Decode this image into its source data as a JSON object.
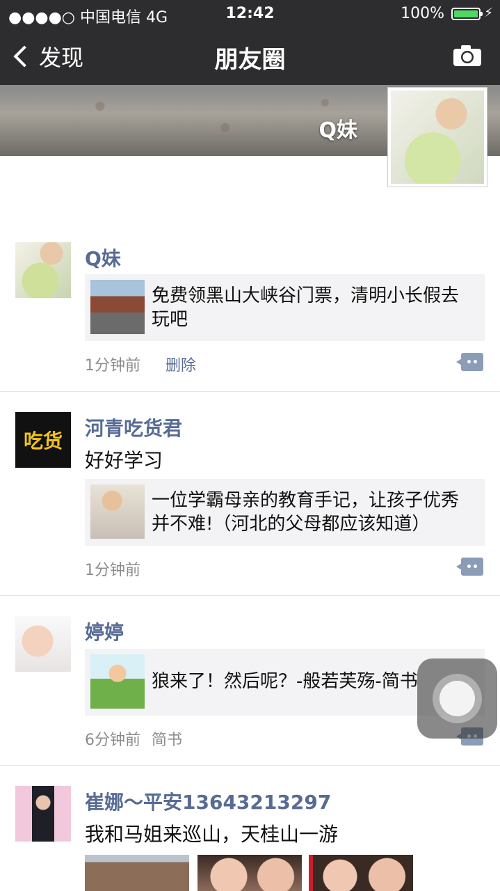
{
  "status_bar": {
    "carrier": "●●●●○ 中国电信  4G",
    "time": "12:42",
    "battery_percent": "100%",
    "battery_level": 1.0,
    "charging_icon": "⚡"
  },
  "nav": {
    "back_label": "发现",
    "title": "朋友圈",
    "camera_icon": "camera-icon"
  },
  "cover": {
    "name": "Q妹"
  },
  "posts": [
    {
      "user": "Q妹",
      "share_text": "免费领黑山大峡谷门票，清明小长假去玩吧",
      "time": "1分钟前",
      "delete_label": "删除"
    },
    {
      "user": "河青吃货君",
      "text": "好好学习",
      "share_text": "一位学霸母亲的教育手记，让孩子优秀并不难!（河北的父母都应该知道）",
      "time": "1分钟前",
      "avatar_text": "吃货"
    },
    {
      "user": "婷婷",
      "share_text": "狼来了！然后呢？-般若芙殇-简书",
      "time": "6分钟前",
      "source": "简书"
    },
    {
      "user": "崔娜～平安13643213297",
      "text": "我和马姐来巡山，天桂山一游"
    }
  ],
  "colors": {
    "nav_bg": "#2d2d2f",
    "username": "#576b95",
    "share_bg": "#f3f3f5",
    "meta": "#8c8c8c",
    "battery": "#4cd964"
  }
}
